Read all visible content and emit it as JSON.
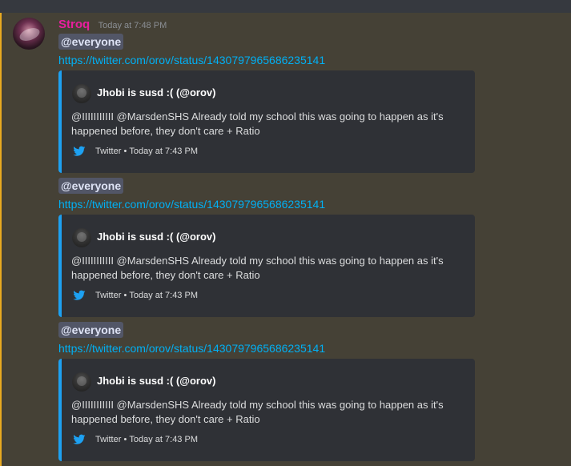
{
  "message": {
    "author": "Stroq",
    "timestamp": "Today at 7:48 PM",
    "author_color": "#e91e9e",
    "avatar_icon": "user-avatar",
    "blocks": [
      {
        "mention": "@everyone",
        "link": "https://twitter.com/orov/status/1430797965686235141",
        "embed": {
          "author": "Jhobi is susd :( (@orov)",
          "description": "@IIIIIIIIIII @MarsdenSHS Already told my school this was going to happen as it's happened before, they don't care + Ratio",
          "footer_icon": "twitter-bird-icon",
          "footer_source": "Twitter",
          "footer_time": "Today at 7:43 PM"
        }
      },
      {
        "mention": "@everyone",
        "link": "https://twitter.com/orov/status/1430797965686235141",
        "embed": {
          "author": "Jhobi is susd :( (@orov)",
          "description": "@IIIIIIIIIII @MarsdenSHS Already told my school this was going to happen as it's happened before, they don't care + Ratio",
          "footer_icon": "twitter-bird-icon",
          "footer_source": "Twitter",
          "footer_time": "Today at 7:43 PM"
        }
      },
      {
        "mention": "@everyone",
        "link": "https://twitter.com/orov/status/1430797965686235141",
        "embed": {
          "author": "Jhobi is susd :( (@orov)",
          "description": "@IIIIIIIIIII @MarsdenSHS Already told my school this was going to happen as it's happened before, they don't care + Ratio",
          "footer_icon": "twitter-bird-icon",
          "footer_source": "Twitter",
          "footer_time": "Today at 7:43 PM"
        }
      }
    ]
  },
  "colors": {
    "background": "#454136",
    "mention_highlight": "#e8a920",
    "link": "#00b0f4",
    "embed_bg": "#2f3136",
    "embed_border": "#1da1f2"
  }
}
